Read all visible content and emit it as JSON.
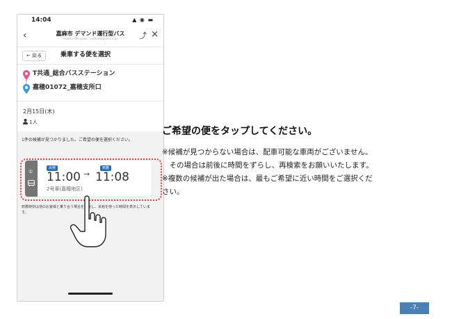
{
  "status_bar": {
    "time": "14:04",
    "indicators": "▲ ◉ ▬"
  },
  "nav": {
    "back_icon": "‹",
    "title": "嘉麻市 デマンド運行型バス",
    "url": "mobili-life-paas...echnologies.co.jp",
    "share_icon": "⤴",
    "close_icon": "×"
  },
  "header": {
    "back_label": "← 戻る",
    "title": "乗車する便を選択"
  },
  "route": {
    "origin": "T共通_総合バスステーション",
    "destination": "嘉穂01072_嘉穂支所口"
  },
  "trip": {
    "date": "2月15日(木)",
    "passengers": "1人"
  },
  "message": "1件の候補が見つかりました。ご希望の便を選択ください。",
  "candidate": {
    "index": "①",
    "departure_tag": "出発",
    "departure_time": "11:00",
    "arrow": "→",
    "arrival_tag": "到着",
    "arrival_time": "11:08",
    "vehicle": "2号車(嘉穂地区)"
  },
  "hint": "到着時刻は他のお客様と乗り合う場合を考慮し、余裕を持った時間を表示しています。",
  "instructions": {
    "headline": "ご希望の便をタップしてください。",
    "lines": [
      "※候補が見つからない場合は、配車可能な車両がございません。",
      "　その場合は前後に時間をずらし、再検索をお願いいたします。",
      "※複数の候補が出た場合は、最もご希望に近い時間をご選択くだ",
      "さい。"
    ]
  },
  "page_number": "-7-",
  "colors": {
    "accent_blue": "#2a69b5",
    "highlight_red": "#e03a3a",
    "badge_blue": "#4a80b8",
    "origin_pin": "#e0558a",
    "destination_pin": "#3b9ad9"
  }
}
